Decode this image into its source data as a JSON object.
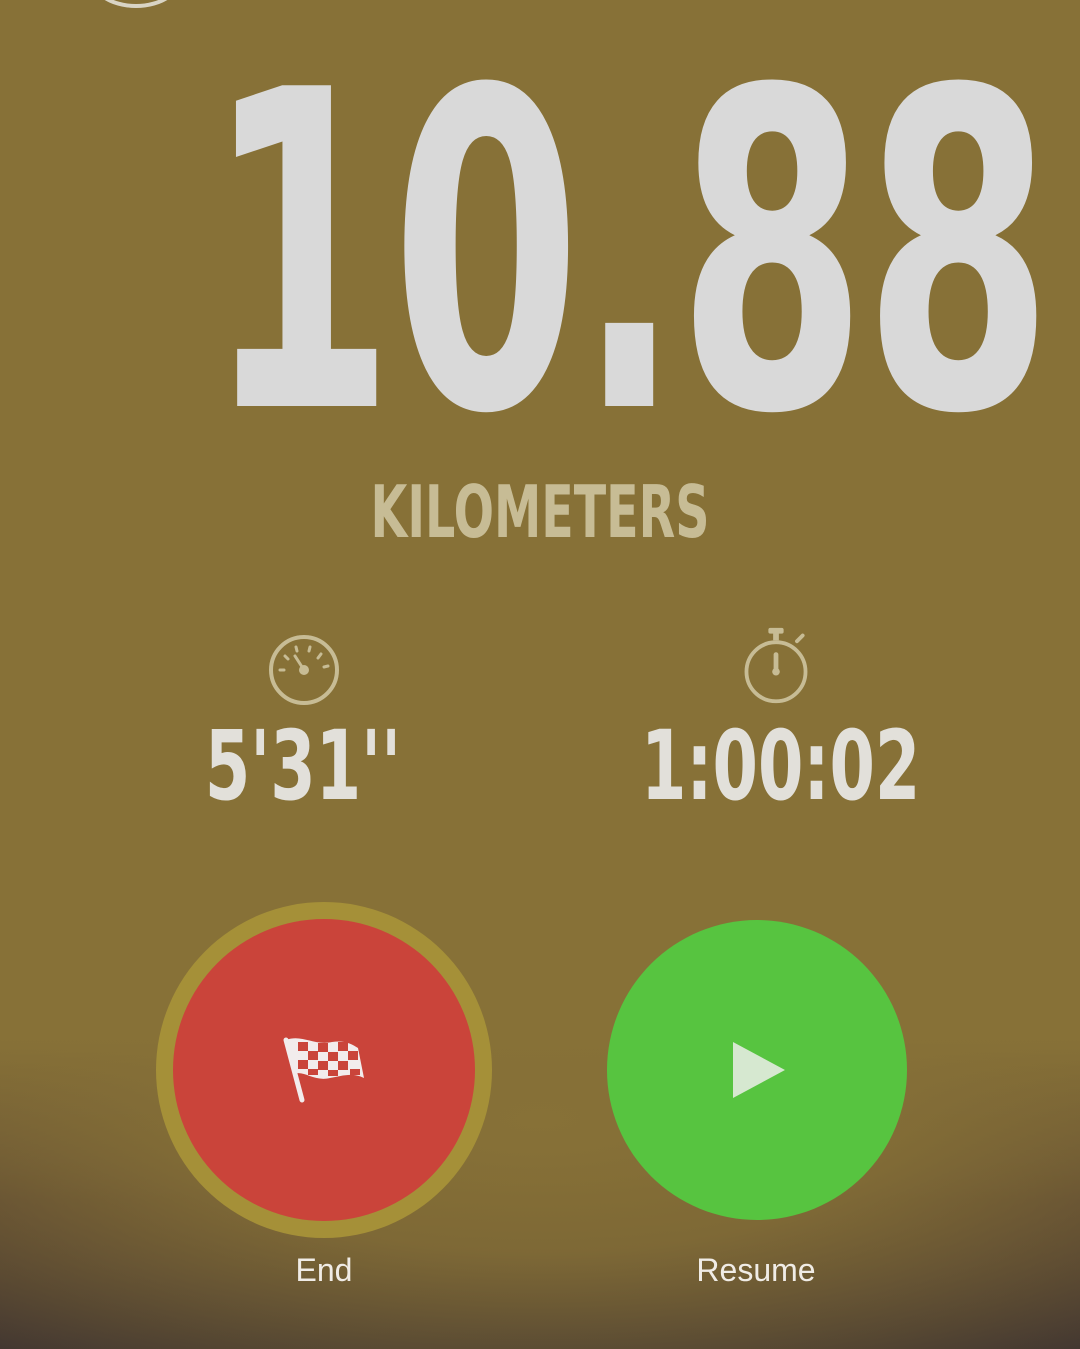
{
  "run": {
    "distance": "10.88",
    "unit": "KILOMETERS"
  },
  "stats": {
    "pace": {
      "icon": "speedometer-icon",
      "value": "5'31''"
    },
    "duration": {
      "icon": "stopwatch-icon",
      "value": "1:00:02"
    }
  },
  "controls": {
    "end": {
      "icon": "checkered-flag-icon",
      "label": "End",
      "color": "#ca443a",
      "ring_color": "#a59038"
    },
    "resume": {
      "icon": "play-icon",
      "label": "Resume",
      "color": "#57c440"
    }
  },
  "colors": {
    "background": "#877137",
    "primary_text": "#d9d9d9",
    "secondary_text": "#c7bc95"
  }
}
